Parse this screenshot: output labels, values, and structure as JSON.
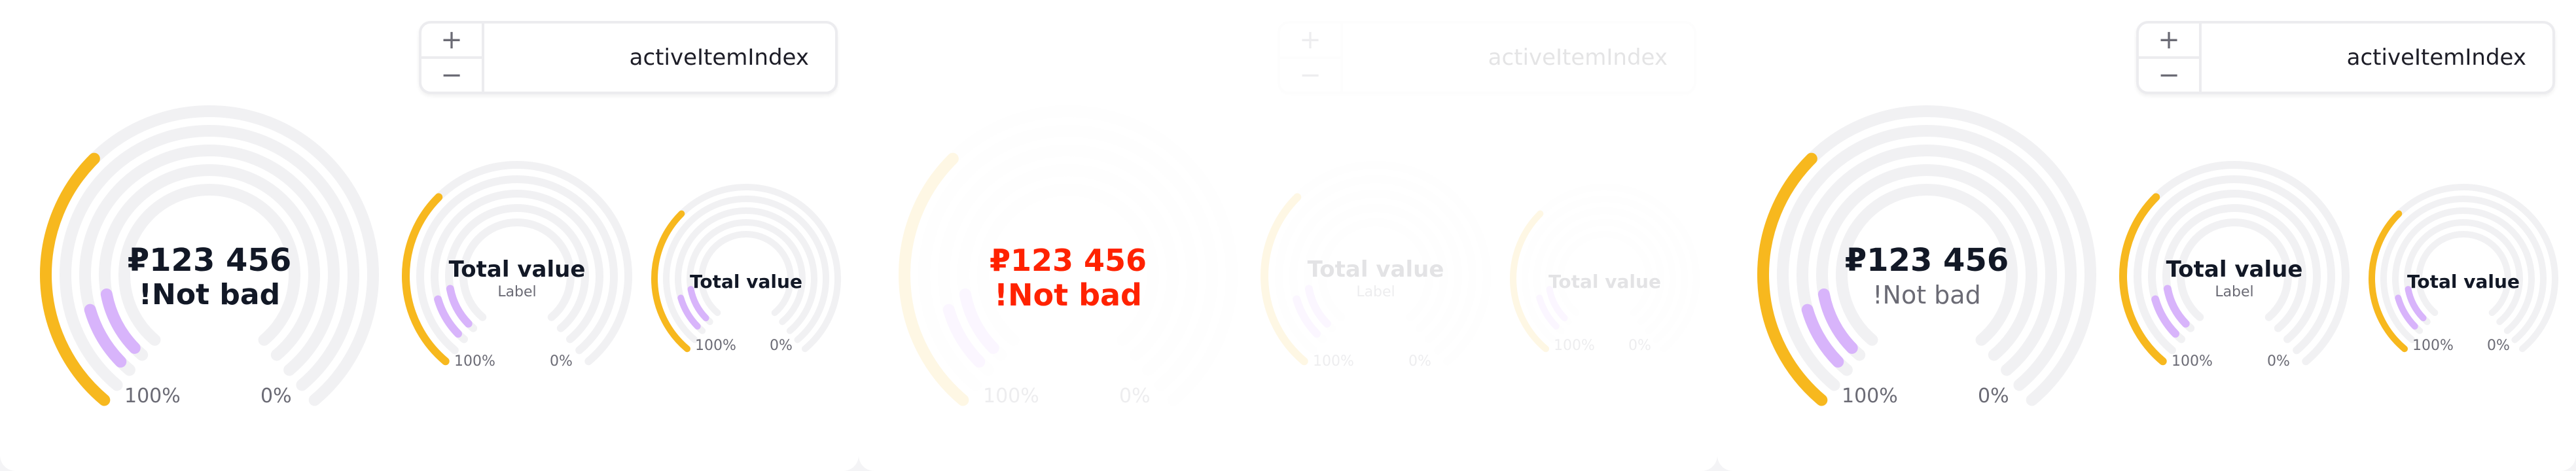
{
  "colors": {
    "track": "#f1f1f3",
    "accent": "#f7b81e",
    "secondary": "#d8b4fb",
    "text": "#121826",
    "muted": "#6b6b75",
    "error": "#ff2200"
  },
  "stepper": {
    "increment_icon": "plus-icon",
    "decrement_icon": "minus-icon",
    "plus": "+",
    "minus": "−",
    "value": "activeItemIndex"
  },
  "gauges": {
    "large": {
      "amount": "₽123 456",
      "label_bold": "!Not bad",
      "label": "!Not bad",
      "min_label": "100%",
      "max_label": "0%",
      "primary_progress": 0.34,
      "secondary_progress": 0.12
    },
    "medium": {
      "amount": "Total value",
      "label": "Label",
      "min_label": "100%",
      "max_label": "0%",
      "primary_progress": 0.34,
      "secondary_progress": 0.12
    },
    "small": {
      "amount": "Total value",
      "min_label": "100%",
      "max_label": "0%",
      "primary_progress": 0.34,
      "secondary_progress": 0.12
    }
  }
}
